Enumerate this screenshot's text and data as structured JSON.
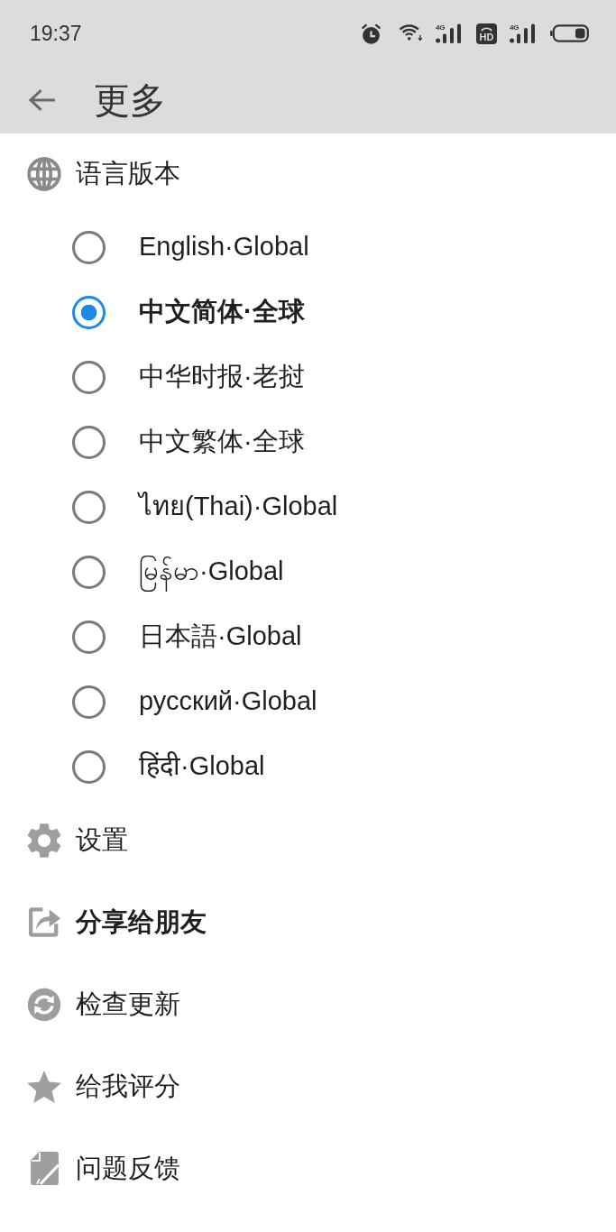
{
  "status_bar": {
    "time": "19:37",
    "signal_1_label": "4G",
    "hd_label": "HD",
    "signal_2_label": "4G"
  },
  "app_bar": {
    "title": "更多"
  },
  "language_section": {
    "title": "语言版本",
    "options": [
      {
        "label": "English·Global",
        "selected": false
      },
      {
        "label": "中文简体·全球",
        "selected": true
      },
      {
        "label": "中华时报·老挝",
        "selected": false
      },
      {
        "label": "中文繁体·全球",
        "selected": false
      },
      {
        "label": "ไทย(Thai)·Global",
        "selected": false
      },
      {
        "label": "မြန်မာ·Global",
        "selected": false
      },
      {
        "label": "日本語·Global",
        "selected": false
      },
      {
        "label": "русский·Global",
        "selected": false
      },
      {
        "label": "हिंदी·Global",
        "selected": false
      }
    ]
  },
  "menu": [
    {
      "label": "设置",
      "bold": false
    },
    {
      "label": "分享给朋友",
      "bold": true
    },
    {
      "label": "检查更新",
      "bold": false
    },
    {
      "label": "给我评分",
      "bold": false
    },
    {
      "label": "问题反馈",
      "bold": false
    }
  ]
}
